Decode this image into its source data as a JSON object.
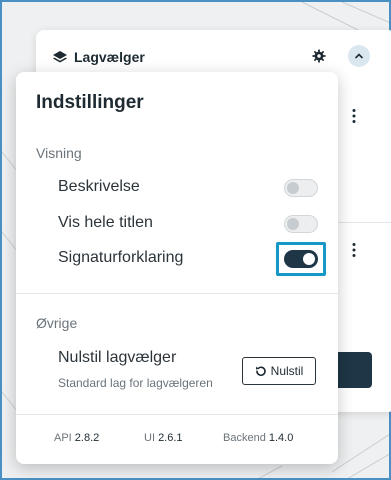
{
  "layer_picker": {
    "title": "Lagvælger",
    "icons": {
      "title_icon": "layers-icon",
      "settings": "gear-icon",
      "collapse": "chevron-up-icon",
      "item_menu": "kebab-menu-icon"
    }
  },
  "settings": {
    "title": "Indstillinger",
    "sections": {
      "display": {
        "label": "Visning",
        "items": [
          {
            "label": "Beskrivelse",
            "enabled": false
          },
          {
            "label": "Vis hele titlen",
            "enabled": false
          },
          {
            "label": "Signaturforklaring",
            "enabled": true
          }
        ]
      },
      "other": {
        "label": "Øvrige",
        "reset": {
          "title": "Nulstil lagvælger",
          "description": "Standard lag for lagvælgeren",
          "button_label": "Nulstil",
          "button_icon": "reset-icon"
        }
      }
    },
    "versions": {
      "api_label": "API",
      "api_value": "2.8.2",
      "ui_label": "UI",
      "ui_value": "2.6.1",
      "backend_label": "Backend",
      "backend_value": "1.4.0"
    }
  },
  "colors": {
    "accent_dark": "#1e3646",
    "focus_ring": "#1597c7",
    "frame_border": "#4a90c2"
  }
}
